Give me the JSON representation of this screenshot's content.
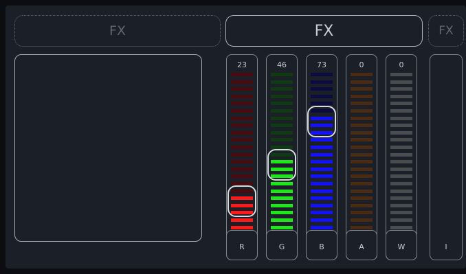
{
  "fx_buttons": {
    "left": "FX",
    "middle": "FX",
    "right": "FX"
  },
  "channels": [
    {
      "label": "R",
      "value": "23",
      "level": 23,
      "on": "#ff1a1a",
      "off": "#4a0a0e"
    },
    {
      "label": "G",
      "value": "46",
      "level": 46,
      "on": "#1fe61a",
      "off": "#0f3a12"
    },
    {
      "label": "B",
      "value": "73",
      "level": 73,
      "on": "#1212ff",
      "off": "#0a0b3f"
    },
    {
      "label": "A",
      "value": "0",
      "level": 0,
      "on": "#d96c10",
      "off": "#4a2a10"
    },
    {
      "label": "W",
      "value": "0",
      "level": 0,
      "on": "#e6e6e6",
      "off": "#4a4d4f"
    }
  ],
  "partial_channel_label": "I"
}
